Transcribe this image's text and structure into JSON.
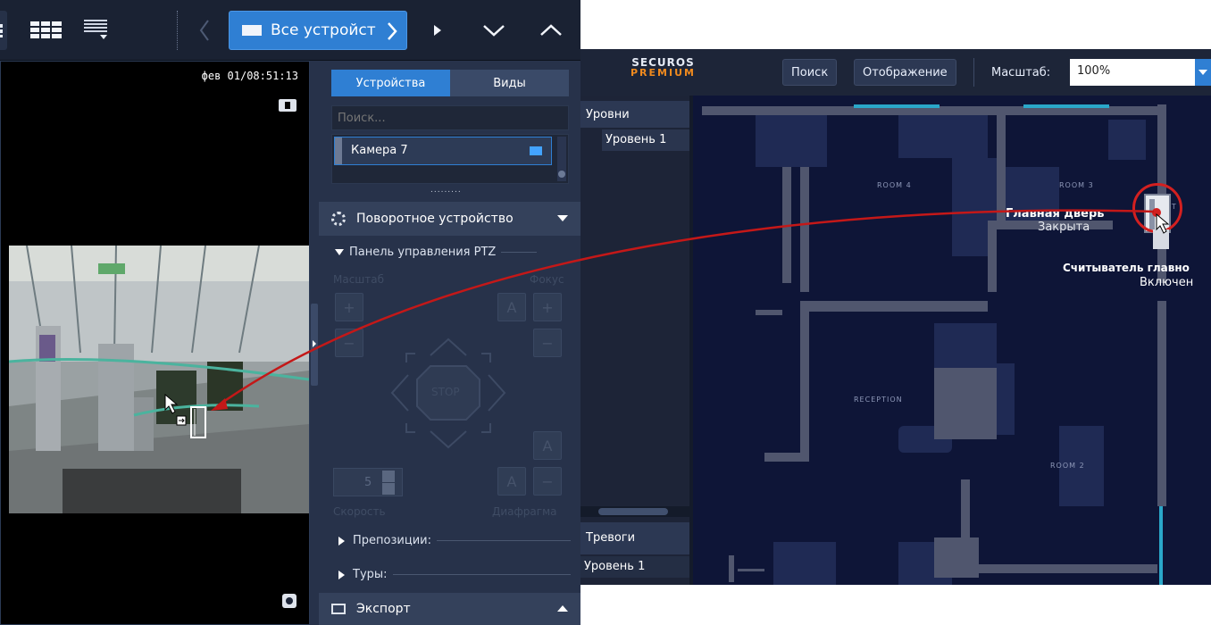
{
  "topbar": {
    "devices_label": "Все устройст",
    "icons": [
      "grid-small-icon",
      "grid-large-icon",
      "grid-dropdown-icon",
      "chevron-left-icon",
      "chevron-right-icon",
      "play-icon",
      "chevron-down-icon",
      "chevron-up-icon"
    ]
  },
  "viewer": {
    "timestamp": "фев 01/08:51:13"
  },
  "side": {
    "tabs": {
      "devices": "Устройства",
      "views": "Виды"
    },
    "search_placeholder": "Поиск...",
    "camera_item": "Камера 7",
    "splitter": ".........",
    "ptz_device_title": "Поворотное устройство",
    "ptz_panel_title": "Панель управления PTZ",
    "zoom_label": "Масштаб",
    "focus_label": "Фокус",
    "stop_label": "STOP",
    "btn_a": "A",
    "btn_plus": "+",
    "btn_minus": "−",
    "speed_value": "5",
    "speed_label": "Скорость",
    "iris_label": "Диафрагма",
    "presets_label": "Препозиции:",
    "tours_label": "Туры:",
    "export_label": "Экспорт"
  },
  "map": {
    "logo_top": "SECUROS",
    "logo_bottom": "PREMIUM",
    "search_btn": "Поиск",
    "display_btn": "Отображение",
    "scale_label": "Масштаб:",
    "scale_value": "100%",
    "levels_header": "Уровни",
    "level_item": "Уровень 1",
    "alarms_header": "Тревоги",
    "alarm_item": "Уровень 1",
    "rooms": {
      "room4": "ROOM 4",
      "room3": "ROOM 3",
      "reception": "RECEPTION",
      "room2": "ROOM 2",
      "exit": "EXIT"
    },
    "door_title": "Главная дверь",
    "door_status": "Закрыта",
    "reader_title": "Считыватель главно",
    "reader_status": "Включен"
  },
  "colors": {
    "accent_blue": "#2f7fd3",
    "alert_red": "#d32020",
    "logo_orange": "#f08a1e"
  }
}
